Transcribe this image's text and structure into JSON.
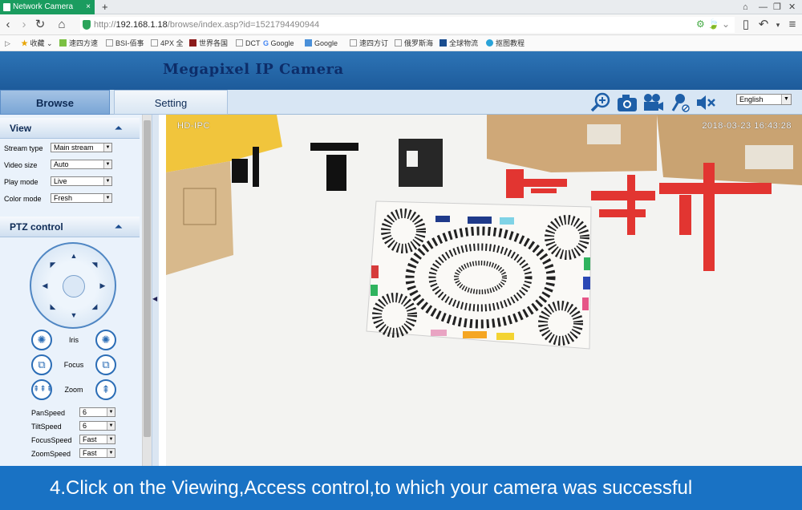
{
  "browser": {
    "tab_title": "Network Camera",
    "new_tab": "+",
    "url_prefix": "http://",
    "url_host": "192.168.1.18",
    "url_path": "/browse/index.asp?id=1521794490944",
    "bookmarks": [
      "收藏",
      "速四方速",
      "BSI-佰事",
      "4PX 全",
      "世界各国",
      "DCT",
      "Google",
      "Google",
      "速四方订",
      "俄罗斯海",
      "全球物流",
      "抠图教程"
    ]
  },
  "app": {
    "title": "Megapixel IP Camera",
    "tabs": {
      "browse": "Browse",
      "setting": "Setting"
    },
    "language": "English"
  },
  "view_section": {
    "title": "View",
    "fields": [
      {
        "label": "Stream type",
        "value": "Main stream"
      },
      {
        "label": "Video size",
        "value": "Auto"
      },
      {
        "label": "Play mode",
        "value": "Live"
      },
      {
        "label": "Color mode",
        "value": "Fresh"
      }
    ]
  },
  "ptz_section": {
    "title": "PTZ control",
    "controls": {
      "iris": "Iris",
      "focus": "Focus",
      "zoom": "Zoom"
    },
    "speeds": [
      {
        "label": "PanSpeed",
        "value": "6"
      },
      {
        "label": "TiltSpeed",
        "value": "6"
      },
      {
        "label": "FocusSpeed",
        "value": "Fast"
      },
      {
        "label": "ZoomSpeed",
        "value": "Fast"
      }
    ]
  },
  "video": {
    "channel": "HD-IPC",
    "timestamp": "2018-03-23  16:43:28"
  },
  "caption": "4.Click on the Viewing,Access control,to which your camera was successful"
}
